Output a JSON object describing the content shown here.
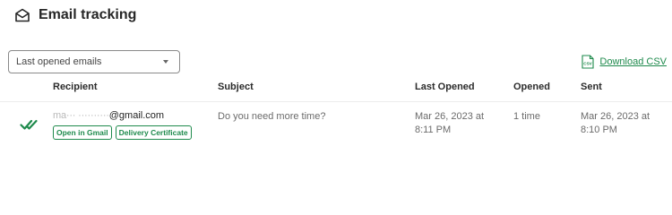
{
  "header": {
    "title": "Email tracking"
  },
  "filter": {
    "selected": "Last opened emails"
  },
  "download": {
    "label": "Download CSV",
    "icon_text": "CSV"
  },
  "table": {
    "columns": [
      "Recipient",
      "Subject",
      "Last Opened",
      "Opened",
      "Sent"
    ],
    "rows": [
      {
        "recipient_hidden": "ma··· ··········",
        "recipient_domain": "@gmail.com",
        "actions": [
          "Open in Gmail",
          "Delivery Certificate"
        ],
        "subject": "Do you need more time?",
        "last_opened_line1": "Mar 26, 2023 at",
        "last_opened_line2": "8:11 PM",
        "opened": "1 time",
        "sent_line1": "Mar 26, 2023 at",
        "sent_line2": "8:10 PM"
      }
    ]
  },
  "colors": {
    "accent": "#1e8a4c",
    "header_text": "#262626",
    "cell_text": "#6b6b6b"
  }
}
